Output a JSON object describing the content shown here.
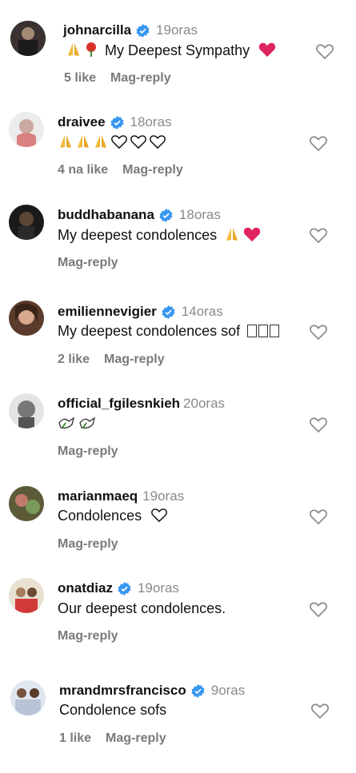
{
  "comments": [
    {
      "username": "johnarcilla",
      "verified": true,
      "time": "19oras",
      "text": "My Deepest Sympathy",
      "likes": "5 like",
      "reply": "Mag-reply"
    },
    {
      "username": "draivee",
      "verified": true,
      "time": "18oras",
      "text": "",
      "likes": "4 na like",
      "reply": "Mag-reply"
    },
    {
      "username": "buddhabanana",
      "verified": true,
      "time": "18oras",
      "text": "My deepest condolences",
      "likes": "",
      "reply": "Mag-reply"
    },
    {
      "username": "emiliennevigier",
      "verified": true,
      "time": "14oras",
      "text": "My deepest condolences sof",
      "likes": "2 like",
      "reply": "Mag-reply"
    },
    {
      "username": "official_fgilesnkieh",
      "verified": false,
      "time": "20oras",
      "text": "",
      "likes": "",
      "reply": "Mag-reply"
    },
    {
      "username": "marianmaeq",
      "verified": false,
      "time": "19oras",
      "text": "Condolences",
      "likes": "",
      "reply": "Mag-reply"
    },
    {
      "username": "onatdiaz",
      "verified": true,
      "time": "19oras",
      "text": "Our deepest condolences.",
      "likes": "",
      "reply": "Mag-reply"
    },
    {
      "username": "mrandmrsfrancisco",
      "verified": true,
      "time": "9oras",
      "text": "Condolence sofs",
      "likes": "1 like",
      "reply": "Mag-reply"
    }
  ],
  "colors": {
    "verified": "#3897f0",
    "heart": "#e0245e",
    "muted": "#8a8a8a"
  }
}
